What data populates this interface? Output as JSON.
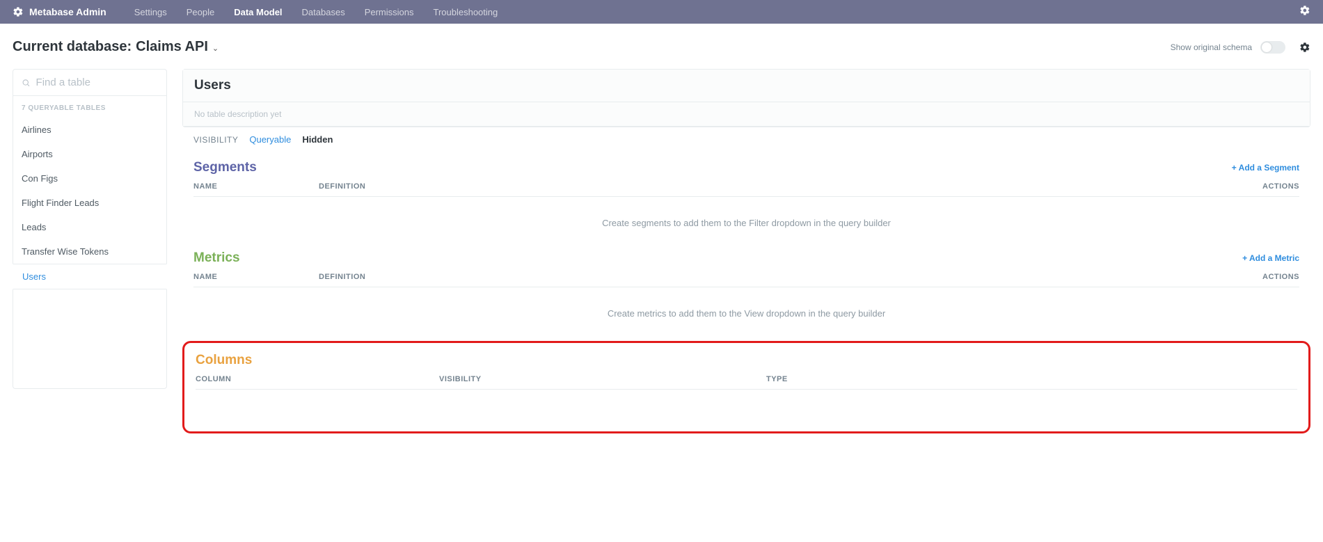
{
  "topnav": {
    "brand": "Metabase Admin",
    "links": [
      "Settings",
      "People",
      "Data Model",
      "Databases",
      "Permissions",
      "Troubleshooting"
    ],
    "active_index": 2
  },
  "subheader": {
    "label_prefix": "Current database:",
    "database_name": "Claims API",
    "show_original_schema_label": "Show original schema"
  },
  "sidebar": {
    "search_placeholder": "Find a table",
    "tables_caption": "7 QUERYABLE TABLES",
    "tables": [
      "Airlines",
      "Airports",
      "Con Figs",
      "Flight Finder Leads",
      "Leads",
      "Transfer Wise Tokens",
      "Users"
    ],
    "active_index": 6
  },
  "panel": {
    "title": "Users",
    "description_placeholder": "No table description yet",
    "visibility": {
      "label": "VISIBILITY",
      "options": [
        "Queryable",
        "Hidden"
      ],
      "selected_index": 0
    }
  },
  "segments": {
    "title": "Segments",
    "add_label": "+ Add a Segment",
    "columns": [
      "NAME",
      "DEFINITION",
      "ACTIONS"
    ],
    "empty_hint": "Create segments to add them to the Filter dropdown in the query builder"
  },
  "metrics": {
    "title": "Metrics",
    "add_label": "+ Add a Metric",
    "columns": [
      "NAME",
      "DEFINITION",
      "ACTIONS"
    ],
    "empty_hint": "Create metrics to add them to the View dropdown in the query builder"
  },
  "columns_section": {
    "title": "Columns",
    "headers": [
      "COLUMN",
      "VISIBILITY",
      "TYPE"
    ]
  }
}
